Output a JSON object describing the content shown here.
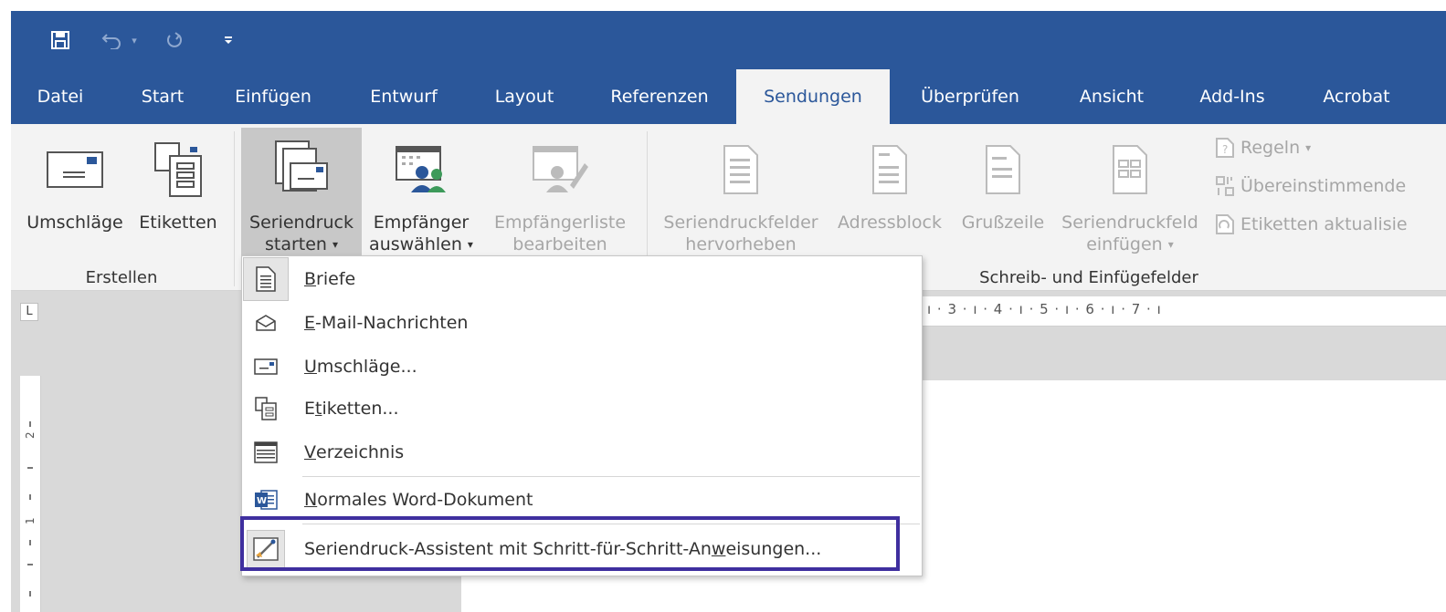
{
  "titlebar": {
    "save_icon": "save-icon",
    "undo_icon": "undo-icon",
    "redo_icon": "redo-icon",
    "customize_icon": "customize-qat-icon"
  },
  "tabs": [
    {
      "label": "Datei"
    },
    {
      "label": "Start"
    },
    {
      "label": "Einfügen"
    },
    {
      "label": "Entwurf"
    },
    {
      "label": "Layout"
    },
    {
      "label": "Referenzen"
    },
    {
      "label": "Sendungen",
      "active": true
    },
    {
      "label": "Überprüfen"
    },
    {
      "label": "Ansicht"
    },
    {
      "label": "Add-Ins"
    },
    {
      "label": "Acrobat"
    }
  ],
  "ribbon": {
    "erstellen": {
      "label": "Erstellen",
      "umschlaege": "Umschläge",
      "etiketten": "Etiketten"
    },
    "seriendruck": {
      "line1": "Seriendruck",
      "line2": "starten"
    },
    "empfaenger": {
      "line1": "Empfänger",
      "line2": "auswählen"
    },
    "empfaengerliste": {
      "line1": "Empfängerliste",
      "line2": "bearbeiten"
    },
    "felder": {
      "label": "Schreib- und Einfügefelder",
      "hervorheben_1": "Seriendruckfelder",
      "hervorheben_2": "hervorheben",
      "adressblock": "Adressblock",
      "grusszeile": "Grußzeile",
      "einfuegen_1": "Seriendruckfeld",
      "einfuegen_2": "einfügen",
      "regeln": "Regeln",
      "uebereinstimmende": "Übereinstimmende",
      "etiketten_aktualisieren": "Etiketten aktualisie"
    }
  },
  "ruler": {
    "tab_selector": "L",
    "h_text": "ı · 3 · ı · 4 · ı · 5 · ı · 6 · ı · 7 · ı"
  },
  "menu": {
    "items": [
      {
        "pre": "",
        "ul": "B",
        "post": "riefe",
        "icon": "letter-icon"
      },
      {
        "pre": "",
        "ul": "E",
        "post": "-Mail-Nachrichten",
        "icon": "email-envelope-icon"
      },
      {
        "pre": "",
        "ul": "U",
        "post": "mschläge...",
        "icon": "envelope-icon"
      },
      {
        "pre": "E",
        "ul": "t",
        "post": "iketten...",
        "icon": "labels-icon"
      },
      {
        "pre": "",
        "ul": "V",
        "post": "erzeichnis",
        "icon": "directory-icon"
      },
      {
        "pre": "",
        "ul": "N",
        "post": "ormales Word-Dokument",
        "icon": "word-document-icon"
      },
      {
        "pre": "Seriendruck-Assistent mit Schritt-für-Schritt-An",
        "ul": "w",
        "post": "eisungen...",
        "icon": "mail-merge-wizard-icon"
      }
    ]
  },
  "colors": {
    "title_bar": "#2b579a",
    "ribbon_bg": "#f3f3f3",
    "highlight_border": "#3f2f9f"
  }
}
